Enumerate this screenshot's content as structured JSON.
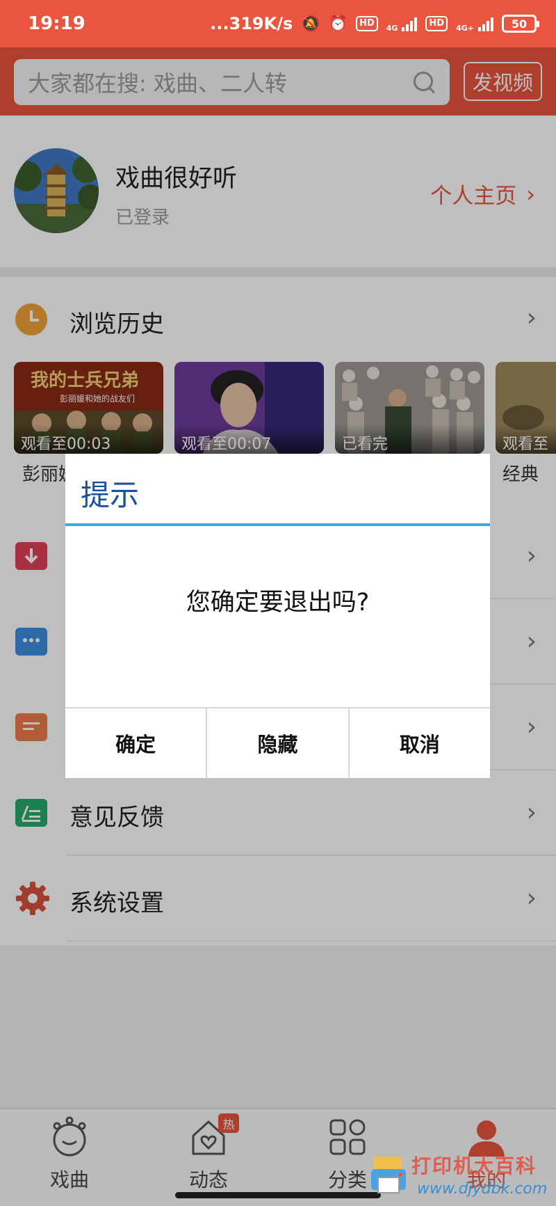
{
  "status_bar": {
    "time": "19:19",
    "net_speed": "...319K/s",
    "net_type_1": "4G",
    "net_type_2": "4G+",
    "hd_label": "HD",
    "battery": "50"
  },
  "header": {
    "search_placeholder": "大家都在搜: 戏曲、二人转",
    "upload_label": "发视频"
  },
  "profile": {
    "name": "戏曲很好听",
    "status": "已登录",
    "homepage_link": "个人主页"
  },
  "history": {
    "title": "浏览历史",
    "items": [
      {
        "progress": "观看至00:03",
        "caption": "彭丽媛 兵"
      },
      {
        "progress": "观看至00:07",
        "caption": ""
      },
      {
        "progress": "已看完",
        "caption": ""
      },
      {
        "progress": "观看至",
        "caption": "经典"
      }
    ],
    "thumb1_text": "我的士兵兄弟",
    "thumb1_sub": "彭丽媛和她的战友们"
  },
  "menu": {
    "items": [
      {
        "label": ""
      },
      {
        "label": ""
      },
      {
        "label": ""
      },
      {
        "label": "意见反馈"
      },
      {
        "label": "系统设置"
      }
    ]
  },
  "dialog": {
    "title": "提示",
    "message": "您确定要退出吗?",
    "buttons": [
      "确定",
      "隐藏",
      "取消"
    ]
  },
  "bottom_nav": {
    "items": [
      {
        "label": "戏曲",
        "icon": "opera-mask-icon"
      },
      {
        "label": "动态",
        "icon": "heart-house-icon",
        "badge": "热"
      },
      {
        "label": "分类",
        "icon": "grid-icon"
      },
      {
        "label": "我的",
        "icon": "person-icon",
        "active": true
      }
    ]
  },
  "watermark": {
    "text": "打印机大百科",
    "url": "www.djydbk.com"
  },
  "colors": {
    "brand": "#e9553e",
    "dialog_title": "#18519c",
    "dialog_rule": "#43a7d3"
  }
}
